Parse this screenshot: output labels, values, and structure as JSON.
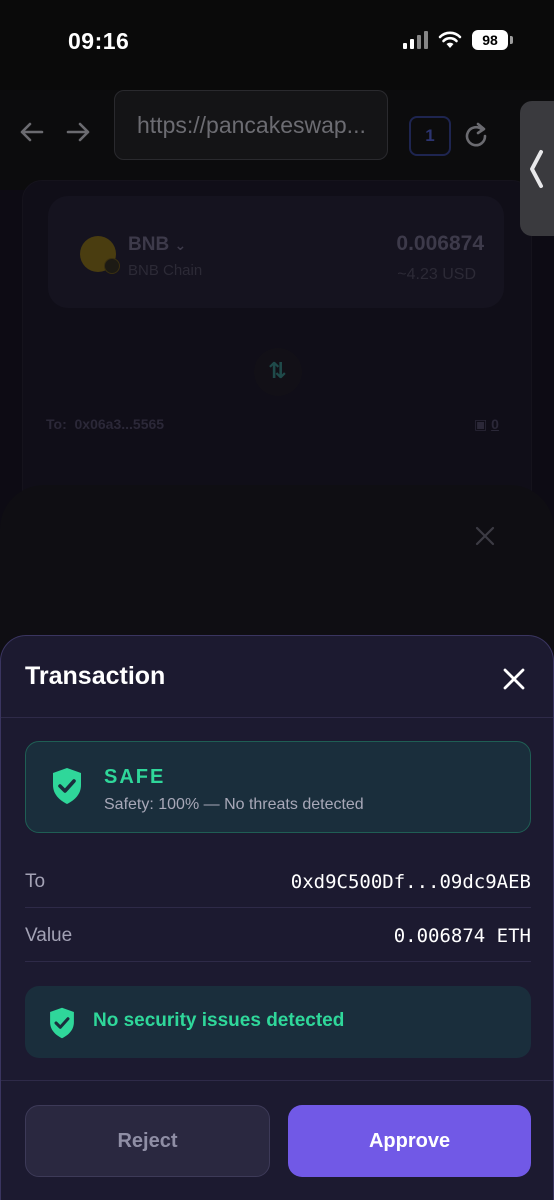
{
  "status_bar": {
    "time": "09:16",
    "battery": "98"
  },
  "browser": {
    "url": "https://pancakeswap...",
    "tab_count": "1"
  },
  "background_page": {
    "token": {
      "symbol": "BNB",
      "chain": "BNB Chain",
      "amount": "0.006874",
      "usd": "~4.23 USD"
    },
    "to_label": "To:",
    "to_address": "0x06a3...5565",
    "wallet_count": "0"
  },
  "transaction": {
    "title": "Transaction",
    "safety": {
      "status": "SAFE",
      "detail": "Safety: 100% — No threats detected"
    },
    "rows": [
      {
        "label": "To",
        "value": "0xd9C500Df...09dc9AEB"
      },
      {
        "label": "Value",
        "value": "0.006874 ETH"
      }
    ],
    "security_message": "No security issues detected",
    "buttons": {
      "reject": "Reject",
      "approve": "Approve"
    }
  },
  "colors": {
    "accent": "#7159e6",
    "safe": "#2fd79a",
    "sheet_bg": "#1c1a30"
  }
}
